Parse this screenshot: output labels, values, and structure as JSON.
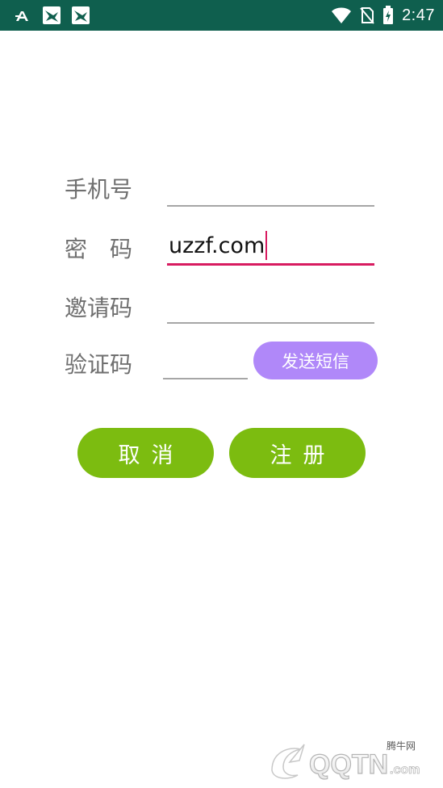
{
  "status_bar": {
    "time": "2:47",
    "left_icons": [
      "a-icon",
      "app-bird-icon",
      "app-bird-icon"
    ],
    "right_icons": [
      "wifi-icon",
      "no-sim-icon",
      "battery-charging-icon"
    ],
    "bg_color": "#0f5f4e"
  },
  "form": {
    "phone": {
      "label": "手机号",
      "value": ""
    },
    "password": {
      "label": "密　码",
      "value": "uzzf.com"
    },
    "invite": {
      "label": "邀请码",
      "value": ""
    },
    "code": {
      "label": "验证码",
      "value": ""
    },
    "send_sms_label": "发送短信"
  },
  "actions": {
    "cancel_label": "取消",
    "register_label": "注册"
  },
  "watermark": {
    "brand": "QQTN",
    "suffix": ".com",
    "cn_name": "腾牛网"
  },
  "colors": {
    "accent_green": "#7cbc10",
    "sms_purple": "#b088f9",
    "focus_pink": "#d81b60",
    "label_gray": "#6f6f6f"
  }
}
